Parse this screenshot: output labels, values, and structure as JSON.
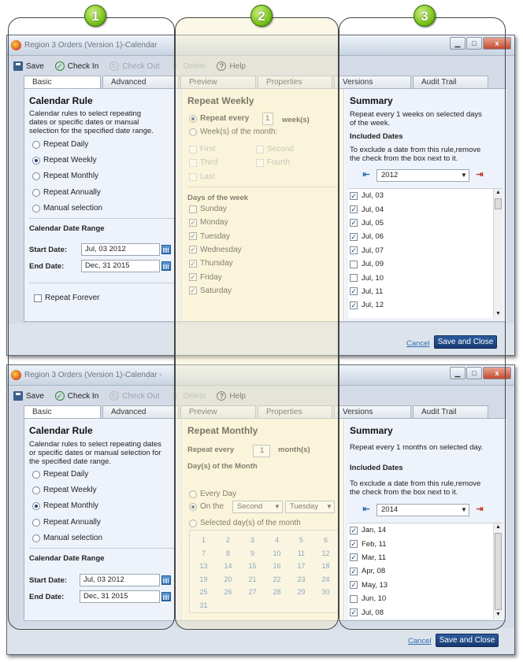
{
  "numbers": [
    "1",
    "2",
    "3"
  ],
  "icons": {
    "app": "firefox-icon",
    "save": "save-icon",
    "checkin": "check-in-icon",
    "checkout": "check-out-icon",
    "delete": "delete-icon",
    "help": "help-icon",
    "calendar": "calendar-icon"
  },
  "colors": {
    "accent": "#2e6db0",
    "primary_button": "#1f4a85",
    "badge_green": "#7bc21a",
    "mid_panel": "#fbf7e6"
  },
  "toolbar": {
    "save": "Save",
    "checkin": "Check In",
    "checkout": "Check Out",
    "delete": "Delete",
    "help": "Help"
  },
  "tabs": [
    "Basic",
    "Advanced",
    "Preview",
    "Properties",
    "Versions",
    "Audit Trail"
  ],
  "window_controls": {
    "minimize": "▁",
    "maximize": "□",
    "close": "x"
  },
  "win1": {
    "title": "Region 3 Orders (Version 1)-Calendar",
    "left": {
      "heading": "Calendar Rule",
      "desc": [
        "Calendar rules to select repeating",
        "dates or specific dates or manual",
        "selection for the specified date range."
      ],
      "options": [
        "Repeat Daily",
        "Repeat Weekly",
        "Repeat Monthly",
        "Repeat Annually",
        "Manual selection"
      ],
      "selected": 1,
      "range_heading": "Calendar Date Range",
      "start_label": "Start Date:",
      "start_value": "Jul, 03 2012",
      "end_label": "End Date:",
      "end_value": "Dec, 31 2015",
      "repeat_forever": "Repeat Forever"
    },
    "mid": {
      "heading": "Repeat Weekly",
      "repeat_every": "Repeat every",
      "repeat_value": "1",
      "unit": "week(s)",
      "weeks_of_month": "Week(s) of the month:",
      "week_choices": [
        "First",
        "Second",
        "Third",
        "Fourth",
        "Last"
      ],
      "days_heading": "Days of the week",
      "days": [
        {
          "label": "Sunday",
          "checked": false
        },
        {
          "label": "Monday",
          "checked": true
        },
        {
          "label": "Tuesday",
          "checked": true
        },
        {
          "label": "Wednesday",
          "checked": true
        },
        {
          "label": "Thursday",
          "checked": true
        },
        {
          "label": "Friday",
          "checked": true
        },
        {
          "label": "Saturday",
          "checked": true
        }
      ]
    },
    "right": {
      "heading": "Summary",
      "summary": [
        "Repeat every 1 weeks on selected days",
        "of the week."
      ],
      "included": "Included Dates",
      "exclude": [
        "To exclude a date from this rule,remove",
        "the check from the box next to it."
      ],
      "year": "2012",
      "dates": [
        {
          "label": "Jul, 03",
          "checked": true
        },
        {
          "label": "Jul, 04",
          "checked": true
        },
        {
          "label": "Jul, 05",
          "checked": true
        },
        {
          "label": "Jul, 06",
          "checked": true
        },
        {
          "label": "Jul, 07",
          "checked": true
        },
        {
          "label": "Jul, 09",
          "checked": false
        },
        {
          "label": "Jul, 10",
          "checked": false
        },
        {
          "label": "Jul, 11",
          "checked": true
        },
        {
          "label": "Jul, 12",
          "checked": true
        }
      ]
    },
    "cancel": "Cancel",
    "save_close": "Save and Close"
  },
  "win2": {
    "title": "Region 3 Orders (Version 1)-Calendar -",
    "left": {
      "heading": "Calendar Rule",
      "desc": [
        "Calendar rules to select repeating dates",
        "or specific dates or manual selection for",
        "the specified date range."
      ],
      "options": [
        "Repeat Daily",
        "Repeat Weekly",
        "Repeat Monthly",
        "Repeat Annually",
        "Manual selection"
      ],
      "selected": 2,
      "range_heading": "Calendar Date Range",
      "start_label": "Start Date:",
      "start_value": "Jul, 03 2012",
      "end_label": "End Date:",
      "end_value": "Dec, 31 2015"
    },
    "mid": {
      "heading": "Repeat Monthly",
      "repeat_every": "Repeat every",
      "repeat_value": "1",
      "unit": "month(s)",
      "days_heading": "Day(s) of the Month",
      "every_day": "Every Day",
      "on_the": "On the",
      "ordinal": "Second",
      "weekday": "Tuesday",
      "selected_days": "Selected day(s) of the month",
      "day_numbers": [
        "1",
        "2",
        "3",
        "4",
        "5",
        "6",
        "7",
        "8",
        "9",
        "10",
        "11",
        "12",
        "13",
        "14",
        "15",
        "16",
        "17",
        "18",
        "19",
        "20",
        "21",
        "22",
        "23",
        "24",
        "25",
        "26",
        "27",
        "28",
        "29",
        "30",
        "31"
      ]
    },
    "right": {
      "heading": "Summary",
      "summary": [
        "Repeat every 1 months on selected day."
      ],
      "included": "Included Dates",
      "exclude": [
        "To exclude a date from this rule,remove",
        "the check from the box next to it."
      ],
      "year": "2014",
      "dates": [
        {
          "label": "Jan, 14",
          "checked": true
        },
        {
          "label": "Feb, 11",
          "checked": true
        },
        {
          "label": "Mar, 11",
          "checked": true
        },
        {
          "label": "Apr, 08",
          "checked": true
        },
        {
          "label": "May, 13",
          "checked": true
        },
        {
          "label": "Jun, 10",
          "checked": false
        },
        {
          "label": "Jul, 08",
          "checked": true
        }
      ]
    },
    "cancel": "Cancel",
    "save_close": "Save and Close"
  }
}
